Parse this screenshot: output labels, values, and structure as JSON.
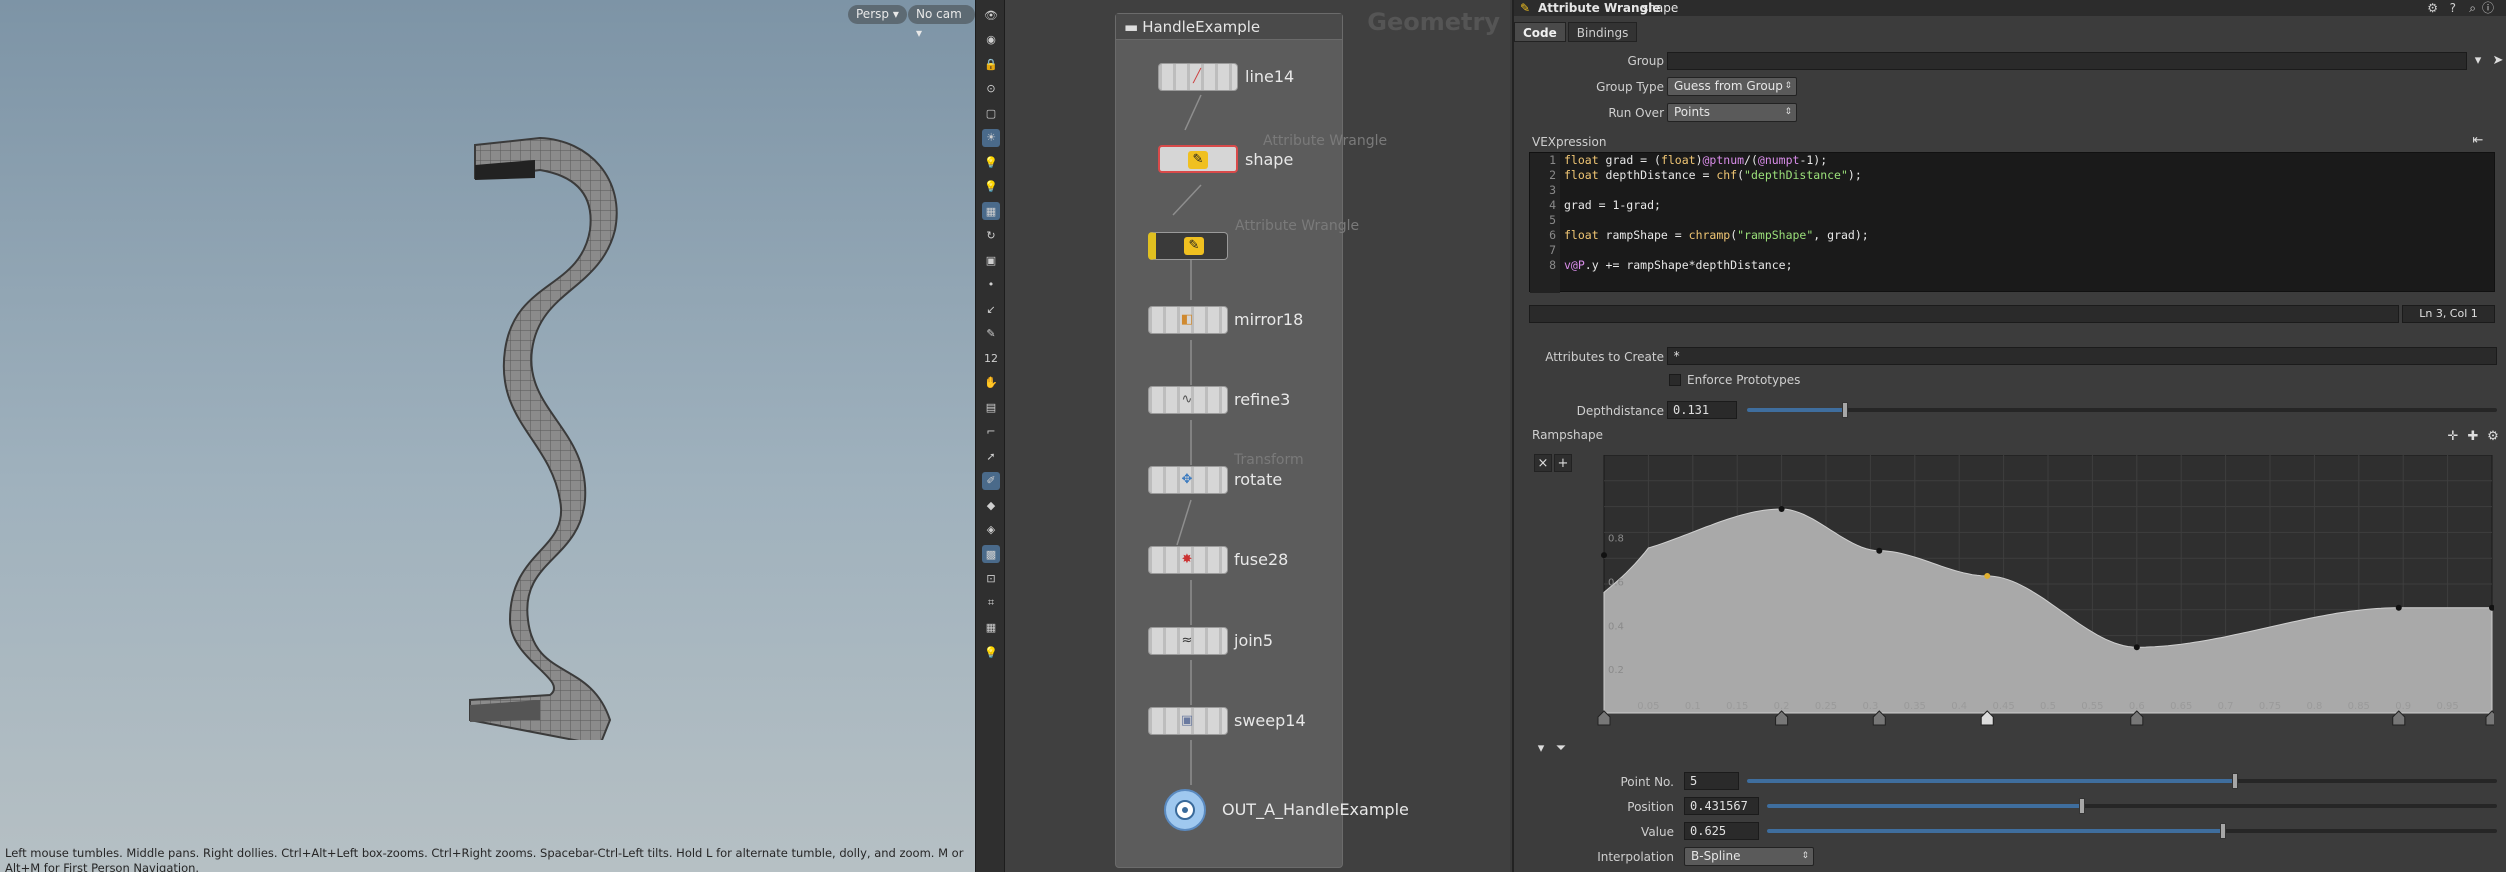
{
  "viewport": {
    "persp_label": "Persp",
    "cam_label": "No cam",
    "status": "Left mouse tumbles. Middle pans. Right dollies. Ctrl+Alt+Left box-zooms. Ctrl+Right zooms. Spacebar-Ctrl-Left tilts. Hold L for alternate tumble, dolly, and zoom.    M or Alt+M for First Person Navigation."
  },
  "toolstrip": {
    "icons": [
      "eye-icon",
      "view-icon",
      "lock-icon",
      "snap-icon",
      "camera-icon",
      "light-icon",
      "lightbulb-icon",
      "lightbulb2-icon",
      "display-icon",
      "tumble-icon",
      "box-icon",
      "point-icon",
      "edge-icon",
      "brush-icon",
      "number-icon",
      "hand-icon",
      "grid-icon",
      "ruler-icon",
      "select-icon",
      "tool-icon",
      "sphere-icon",
      "render-icon",
      "shading-icon",
      "snap2-icon",
      "scale-icon",
      "layout-icon",
      "bulb3-icon"
    ],
    "labels": [
      "12"
    ]
  },
  "network": {
    "context": "Geometry",
    "box_title": "HandleExample",
    "nodes": [
      {
        "label": "line14",
        "ghost": ""
      },
      {
        "label": "shape",
        "ghost": "Attribute Wrangle"
      },
      {
        "label": "",
        "ghost": "Attribute Wrangle"
      },
      {
        "label": "mirror18",
        "ghost": ""
      },
      {
        "label": "refine3",
        "ghost": ""
      },
      {
        "label": "rotate",
        "ghost": "Transform"
      },
      {
        "label": "fuse28",
        "ghost": ""
      },
      {
        "label": "join5",
        "ghost": ""
      },
      {
        "label": "sweep14",
        "ghost": ""
      },
      {
        "label": "OUT_A_HandleExample",
        "ghost": ""
      }
    ]
  },
  "params": {
    "op_type": "Attribute Wrangle",
    "node_name": "shape",
    "tabs": [
      "Code",
      "Bindings"
    ],
    "group_label": "Group",
    "group_value": "",
    "group_type_label": "Group Type",
    "group_type_value": "Guess from Group",
    "run_over_label": "Run Over",
    "run_over_value": "Points",
    "vex_label": "VEXpression",
    "code_lines": [
      "float grad = (float)@ptnum/(@numpt-1);",
      "float depthDistance = chf(\"depthDistance\");",
      "",
      "grad = 1-grad;",
      "",
      "float rampShape = chramp(\"rampShape\", grad);",
      "",
      "v@P.y += rampShape*depthDistance;"
    ],
    "line_numbers": [
      "1",
      "2",
      "3",
      "4",
      "5",
      "6",
      "7",
      "8"
    ],
    "cursor_pos": "Ln 3, Col 1",
    "attrs_label": "Attributes to Create",
    "attrs_value": "*",
    "enforce_label": "Enforce Prototypes",
    "depth_label": "Depthdistance",
    "depth_value": "0.131",
    "depth_fraction": 0.131,
    "ramp_label": "Rampshape",
    "ramp": {
      "x_ticks": [
        "0.05",
        "0.1",
        "0.15",
        "0.2",
        "0.25",
        "0.3",
        "0.35",
        "0.4",
        "0.45",
        "0.5",
        "0.55",
        "0.6",
        "0.65",
        "0.7",
        "0.75",
        "0.8",
        "0.85",
        "0.9",
        "0.95"
      ],
      "y_ticks": [
        "0.2",
        "0.4",
        "0.6",
        "0.8"
      ],
      "points": [
        {
          "pos": 0.0,
          "val": 0.72
        },
        {
          "pos": 0.2,
          "val": 0.93
        },
        {
          "pos": 0.31,
          "val": 0.74
        },
        {
          "pos": 0.431567,
          "val": 0.625
        },
        {
          "pos": 0.6,
          "val": 0.3
        },
        {
          "pos": 0.895,
          "val": 0.48
        },
        {
          "pos": 1.0,
          "val": 0.48
        }
      ],
      "selected_index": 3
    },
    "pointno_label": "Point No.",
    "pointno_value": "5",
    "pointno_fraction": 0.65,
    "position_label": "Position",
    "position_value": "0.431567",
    "position_fraction": 0.431567,
    "value_label": "Value",
    "value_value": "0.625",
    "value_fraction": 0.625,
    "interp_label": "Interpolation",
    "interp_value": "B-Spline"
  }
}
